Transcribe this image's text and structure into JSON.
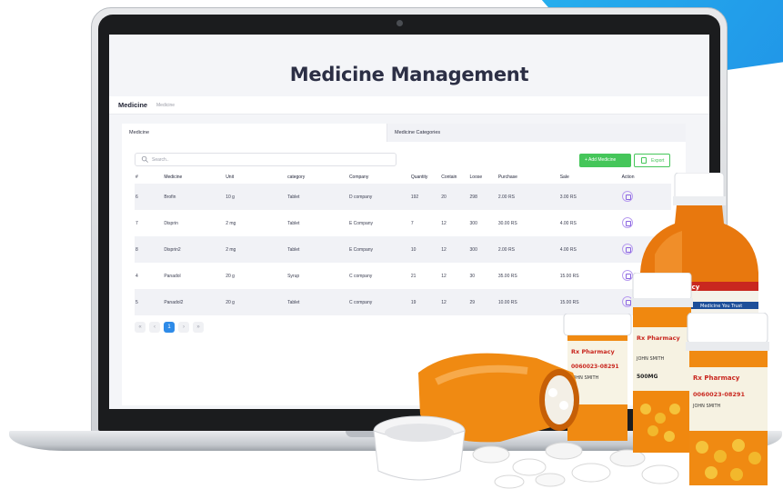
{
  "page": {
    "title": "Medicine Management"
  },
  "breadcrumb": {
    "main": "Medicine",
    "sub": "Medicine"
  },
  "tabs": [
    {
      "label": "Medicine"
    },
    {
      "label": "Medicine Categories"
    }
  ],
  "search": {
    "placeholder": "Search.."
  },
  "toolbar": {
    "add_label": "+ Add Medicine",
    "export_label": "Export"
  },
  "table": {
    "headers": [
      "#",
      "Medicine",
      "Unit",
      "category",
      "Company",
      "Quantity",
      "Contain",
      "Loose",
      "Purchase",
      "Sale",
      "Action"
    ],
    "rows": [
      [
        "6",
        "Brofin",
        "10 g",
        "Tablet",
        "D company",
        "192",
        "20",
        "298",
        "2.00 RS",
        "3.00 RS"
      ],
      [
        "7",
        "Disprin",
        "2 mg",
        "Tablet",
        "E Company",
        "7",
        "12",
        "300",
        "30.00 RS",
        "4.00 RS"
      ],
      [
        "8",
        "Disprin2",
        "2 mg",
        "Tablet",
        "E Company",
        "10",
        "12",
        "300",
        "2.00 RS",
        "4.00 RS"
      ],
      [
        "4",
        "Panadol",
        "20 g",
        "Syrup",
        "C company",
        "21",
        "12",
        "30",
        "35.00 RS",
        "15.00 RS"
      ],
      [
        "5",
        "Panadol2",
        "20 g",
        "Tablet",
        "C company",
        "19",
        "12",
        "29",
        "10.00 RS",
        "15.00 RS"
      ]
    ]
  },
  "pagination": {
    "first": "«",
    "prev": "‹",
    "current": "1",
    "next": "›",
    "last": "»"
  },
  "bottle_labels": {
    "brand": "Rx Pharmacy",
    "rx_number": "0060023-08291",
    "patient": "JOHN SMITH",
    "dose": "500MG",
    "tagline": "Medicine You Trust"
  },
  "colors": {
    "accent_green": "#45c65a",
    "pager_blue": "#2e8be8",
    "bottle_orange": "#f08a12",
    "swoosh_blue": "#1f8fe6"
  }
}
